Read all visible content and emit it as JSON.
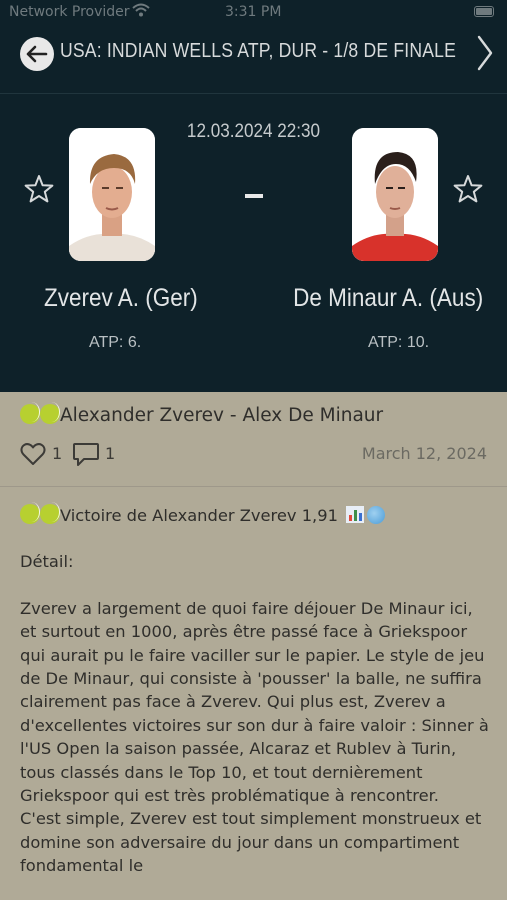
{
  "status_bar": {
    "carrier": "Network Provider",
    "time": "3:31 PM",
    "icons": [
      "wifi-icon",
      "battery-icon"
    ]
  },
  "header": {
    "title": "USA: INDIAN WELLS ATP, DUR - 1/8 DE FINALE",
    "datetime": "12.03.2024 22:30",
    "separator": "-",
    "icons": [
      "back-arrow-icon",
      "chevron-right-icon",
      "star-icon"
    ],
    "colors": {
      "background": "#0e2129",
      "text": "#d7dadb"
    }
  },
  "players": [
    {
      "name": "Zverev A. (Ger)",
      "rank": "ATP: 6."
    },
    {
      "name": "De Minaur A. (Aus)",
      "rank": "ATP: 10."
    }
  ],
  "post": {
    "title": "Alexander Zverev - Alex De Minaur",
    "likes": "1",
    "comments": "1",
    "date": "March 12, 2024",
    "tip": "Victoire de Alexander Zverev 1,91",
    "detail_label": "Détail:",
    "paragraph1": "Zverev a largement de quoi faire déjouer De Minaur ici, et surtout en 1000, après être passé face à Griekspoor qui aurait pu le faire vaciller sur le papier. Le style de jeu de De Minaur, qui consiste à 'pousser' la balle, ne suffira clairement pas face à Zverev. Qui plus est, Zverev a d'excellentes victoires sur son dur à faire valoir : Sinner à l'US Open la saison passée, Alcaraz et Rublev à Turin, tous classés dans le Top 10, et tout dernièrement Griekspoor qui est très problématique à rencontrer.",
    "paragraph2": "C'est simple, Zverev est tout simplement monstrueux et domine son adversaire du jour dans un compartiment fondamental le",
    "icons": [
      "tennis-ball-icon",
      "heart-icon",
      "comment-icon",
      "bar-chart-icon",
      "globe-icon"
    ],
    "colors": {
      "background": "#b0aa97",
      "text": "#2f2e2b"
    }
  }
}
